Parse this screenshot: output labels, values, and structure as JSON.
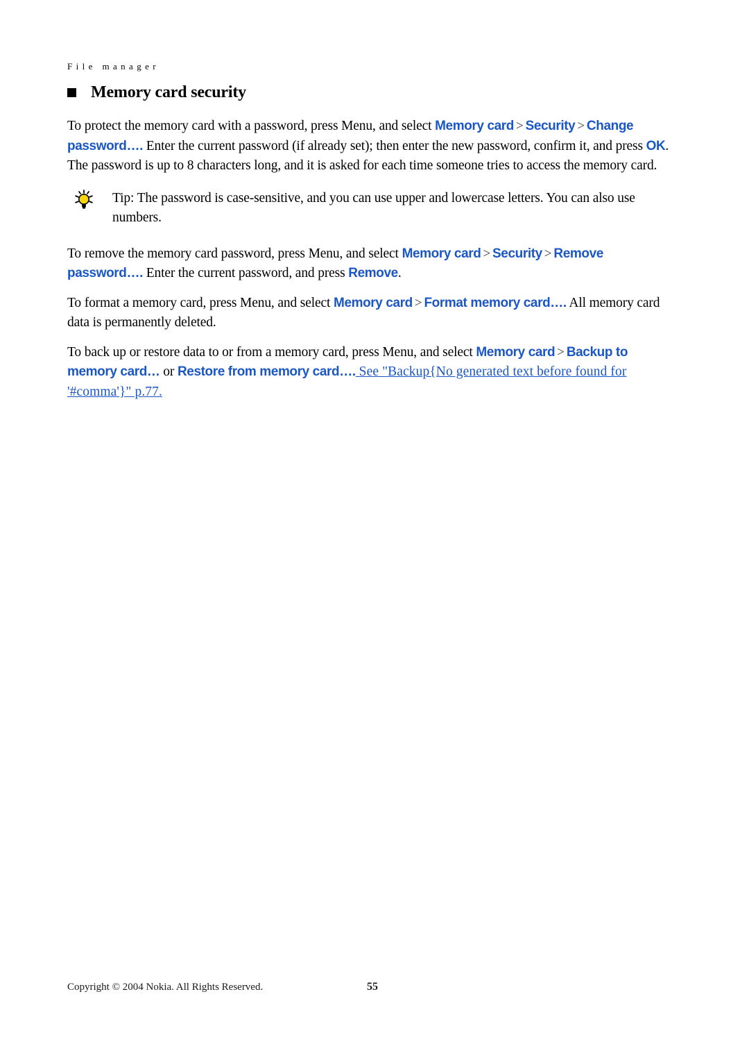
{
  "document": {
    "running_header": "File manager",
    "page_number": "55",
    "copyright": "Copyright © 2004 Nokia. All Rights Reserved."
  },
  "colors": {
    "ui_term_blue": "#1b57c4",
    "body_black": "#000000",
    "separator_gray": "#3a3a3a"
  },
  "section": {
    "heading": "Memory card security",
    "bullet_icon": "filled-square-bullet"
  },
  "paragraphs": {
    "protect": {
      "part1": "To protect the memory card with a password, press Menu, and select ",
      "term1": "Memory card",
      "sep1": ">",
      "term2": "Security",
      "sep2": ">",
      "term3": "Change password….",
      "part2": " Enter the current password (if already set); then enter the new password, confirm it, and press ",
      "term4": "OK",
      "part3": ". The password is up to 8 characters long, and it is asked for each time someone tries to access the memory card."
    },
    "tip": {
      "icon": "lightbulb-tip-icon",
      "label": "Tip: ",
      "text": "The password is case-sensitive, and you can use upper and lowercase letters. You can also use numbers."
    },
    "remove": {
      "part1": "To remove the memory card password, press Menu, and select ",
      "term1": "Memory card",
      "sep1": ">",
      "term2": "Security",
      "sep2": ">",
      "term3": "Remove password….",
      "part2": " Enter the current password, and press ",
      "term4": "Remove",
      "part3": "."
    },
    "format": {
      "part1": "To format a memory card, press Menu, and select ",
      "term1": "Memory card",
      "sep1": ">",
      "term2": "Format memory card….",
      "part2": " All memory card data is permanently deleted."
    },
    "backup": {
      "part1": "To back up or restore data to or from a memory card, press Menu, and select ",
      "term1": "Memory card",
      "sep1": ">",
      "term2": "Backup to memory card…",
      "part2": " or ",
      "term3": "Restore from memory card….",
      "xref": " See \"Backup{No generated text before found for '#comma'}\" p.77."
    }
  }
}
